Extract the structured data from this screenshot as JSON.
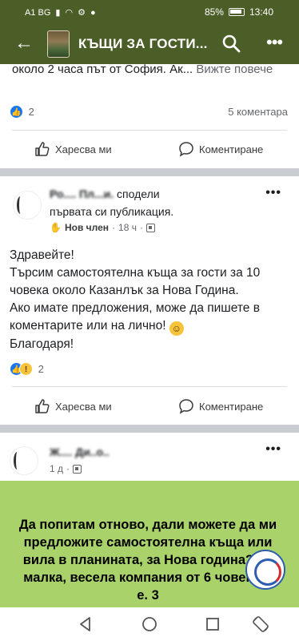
{
  "status_bar": {
    "carrier": "A1 BG",
    "battery": "85%",
    "time": "13:40"
  },
  "header": {
    "title": "КЪЩИ ЗА ГОСТИ...",
    "icons": [
      "back-arrow-icon",
      "search-icon",
      "more-icon"
    ]
  },
  "colors": {
    "header_bg": "#4c5e27",
    "like_blue": "#1877f2",
    "green_post_bg": "#a9d36a",
    "separator": "#c9ccd1"
  },
  "previous_post": {
    "text": "около 2  часа път от София. Ак...",
    "see_more": "Вижте повече",
    "reaction_count": "2",
    "comments": "5 коментара",
    "like_label": "Харесва ми",
    "comment_label": "Коментиране"
  },
  "post2": {
    "author_name": "Ро.... Пл...и.",
    "author_action": "сподели първата си публикация.",
    "badge": "Нов член",
    "time": "18 ч",
    "body": [
      "Здравейте!",
      "Търсим самостоятелна къща за гости за 10 човека около Казанлък за Нова Година.",
      "Ако имате предложения, може да пишете в коментарите или на лично!",
      "Благодаря!"
    ],
    "reaction_count": "2",
    "like_label": "Харесва ми",
    "comment_label": "Коментиране"
  },
  "post3": {
    "author_name": "Ж.... Ди..о..",
    "time": "1 д",
    "body": "Да попитам отново, дали можете да ми предложите самостоятелна къща или вила в планината, за Нова година? За малка, весела компания от 6 човека т. е. 3"
  }
}
